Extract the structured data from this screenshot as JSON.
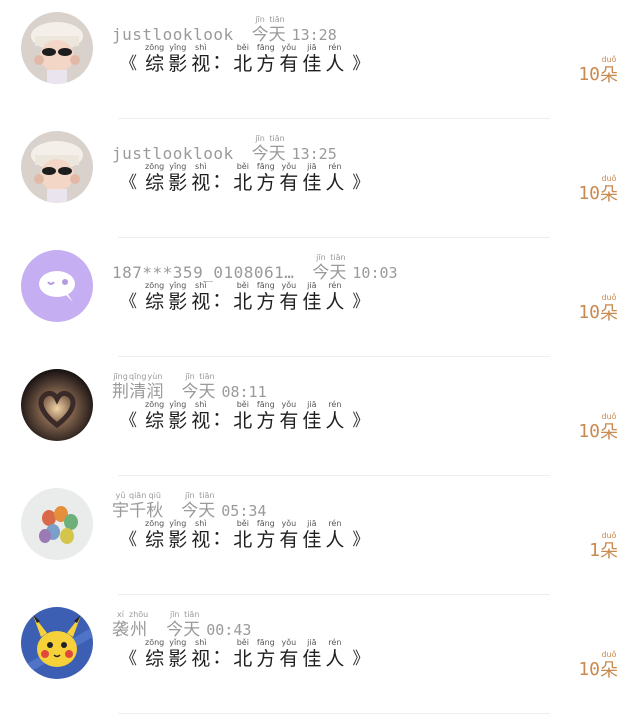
{
  "rows": [
    {
      "username": "justlooklook",
      "name_chars": [],
      "day": {
        "char1": "今",
        "py1": "jīn",
        "char2": "天",
        "py2": "tiān"
      },
      "time": "13:28",
      "avatar": "girl-sunglasses",
      "count_num": "10",
      "count_char": "朵",
      "count_py": "duǒ"
    },
    {
      "username": "justlooklook",
      "name_chars": [],
      "day": {
        "char1": "今",
        "py1": "jīn",
        "char2": "天",
        "py2": "tiān"
      },
      "time": "13:25",
      "avatar": "girl-sunglasses",
      "count_num": "10",
      "count_char": "朵",
      "count_py": "duǒ"
    },
    {
      "username": "187***359_0108061…",
      "name_chars": [],
      "day": {
        "char1": "今",
        "py1": "jīn",
        "char2": "天",
        "py2": "tiān"
      },
      "time": "10:03",
      "avatar": "purple-chat-bubble",
      "count_num": "10",
      "count_char": "朵",
      "count_py": "duǒ"
    },
    {
      "username": "",
      "name_chars": [
        {
          "c": "荆",
          "p": "jīng"
        },
        {
          "c": "清",
          "p": "qīng"
        },
        {
          "c": "润",
          "p": "yùn"
        }
      ],
      "day": {
        "char1": "今",
        "py1": "jīn",
        "char2": "天",
        "py2": "tiān"
      },
      "time": "08:11",
      "avatar": "glowing-heart",
      "count_num": "10",
      "count_char": "朵",
      "count_py": "duǒ"
    },
    {
      "username": "",
      "name_chars": [
        {
          "c": "宇",
          "p": "yǔ"
        },
        {
          "c": "千",
          "p": "qiān"
        },
        {
          "c": "秋",
          "p": "qiū"
        }
      ],
      "day": {
        "char1": "今",
        "py1": "jīn",
        "char2": "天",
        "py2": "tiān"
      },
      "time": "05:34",
      "avatar": "balloons",
      "count_num": "1",
      "count_char": "朵",
      "count_py": "duǒ"
    },
    {
      "username": "",
      "name_chars": [
        {
          "c": "袭",
          "p": "xí"
        },
        {
          "c": "州",
          "p": "zhōu"
        }
      ],
      "day": {
        "char1": "今",
        "py1": "jīn",
        "char2": "天",
        "py2": "tiān"
      },
      "time": "00:43",
      "avatar": "pikachu",
      "count_num": "10",
      "count_char": "朵",
      "count_py": "duǒ"
    }
  ],
  "message": {
    "open": "《",
    "close": "》",
    "colon": "：",
    "chars": [
      {
        "c": "综",
        "p": "zōng"
      },
      {
        "c": "影",
        "p": "yǐng"
      },
      {
        "c": "视",
        "p": "shì"
      },
      {
        "c": "：",
        "p": ""
      },
      {
        "c": "北",
        "p": "běi"
      },
      {
        "c": "方",
        "p": "fāng"
      },
      {
        "c": "有",
        "p": "yǒu"
      },
      {
        "c": "佳",
        "p": "jiā"
      },
      {
        "c": "人",
        "p": "rén"
      }
    ]
  },
  "colors": {
    "accent": "#c98a50",
    "meta": "#9a9a9a",
    "text": "#1f1f1f"
  }
}
